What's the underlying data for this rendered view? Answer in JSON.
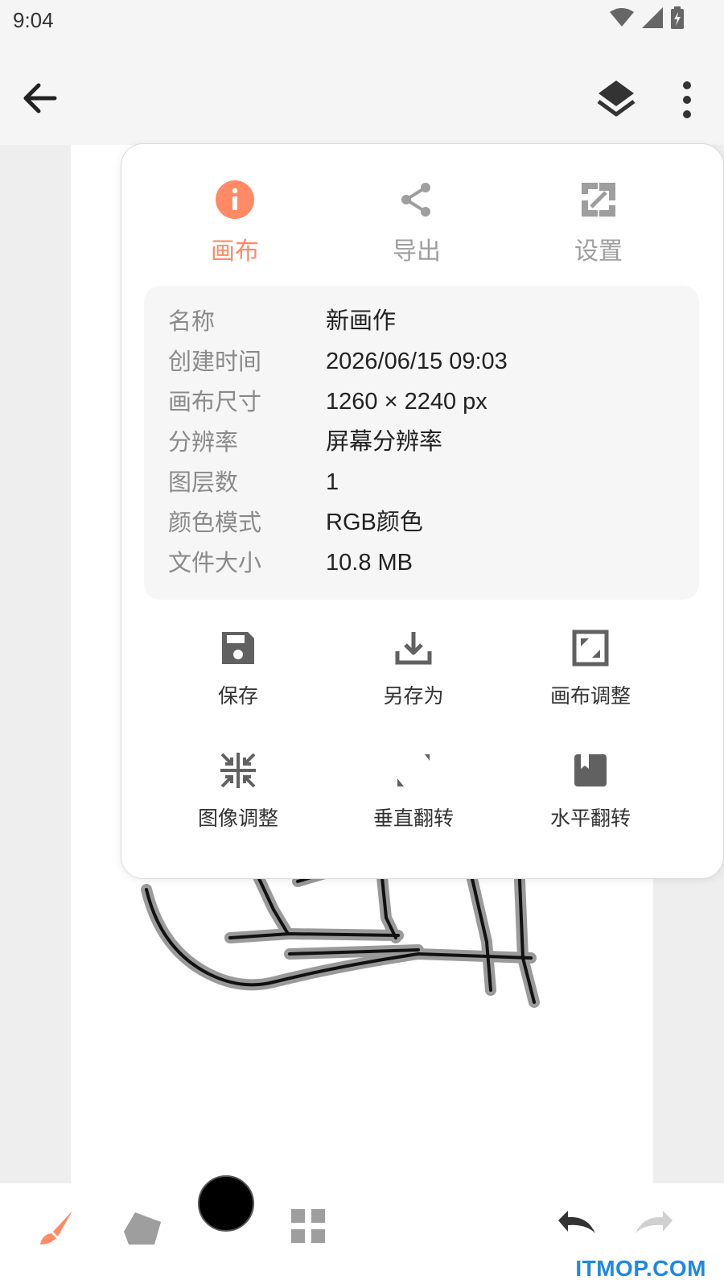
{
  "status_bar": {
    "time": "9:04",
    "icons": [
      "wifi-icon",
      "cellular-signal-icon",
      "battery-charging-icon"
    ]
  },
  "app_bar": {
    "back_icon": "arrow-left-icon",
    "layers_icon": "layers-icon",
    "more_icon": "more-vert-icon"
  },
  "popup": {
    "tabs": [
      {
        "label": "画布",
        "icon": "info-icon",
        "active": true
      },
      {
        "label": "导出",
        "icon": "share-icon",
        "active": false
      },
      {
        "label": "设置",
        "icon": "settings-flip-icon",
        "active": false
      }
    ],
    "info": [
      {
        "key": "名称",
        "value": "新画作"
      },
      {
        "key": "创建时间",
        "value": "2026/06/15 09:03"
      },
      {
        "key": "画布尺寸",
        "value": "1260 × 2240 px"
      },
      {
        "key": "分辨率",
        "value": "屏幕分辨率"
      },
      {
        "key": "图层数",
        "value": "1"
      },
      {
        "key": "颜色模式",
        "value": "RGB颜色"
      },
      {
        "key": "文件大小",
        "value": "10.8 MB"
      }
    ],
    "actions": [
      {
        "label": "保存",
        "icon": "save-icon"
      },
      {
        "label": "另存为",
        "icon": "download-icon"
      },
      {
        "label": "画布调整",
        "icon": "crop-resize-icon"
      },
      {
        "label": "图像调整",
        "icon": "image-resize-icon"
      },
      {
        "label": "垂直翻转",
        "icon": "flip-vertical-icon"
      },
      {
        "label": "水平翻转",
        "icon": "flip-horizontal-icon"
      }
    ]
  },
  "bottom_bar": {
    "tools": [
      "brush-icon",
      "eraser-icon",
      "color-swatch",
      "grid-apps-icon",
      "undo-icon",
      "redo-icon"
    ],
    "current_color": "#000000"
  },
  "colors": {
    "accent": "#ff8a65",
    "icon_gray": "#616161",
    "inactive_gray": "#9e9e9e"
  },
  "watermark": "ITMOP.COM"
}
